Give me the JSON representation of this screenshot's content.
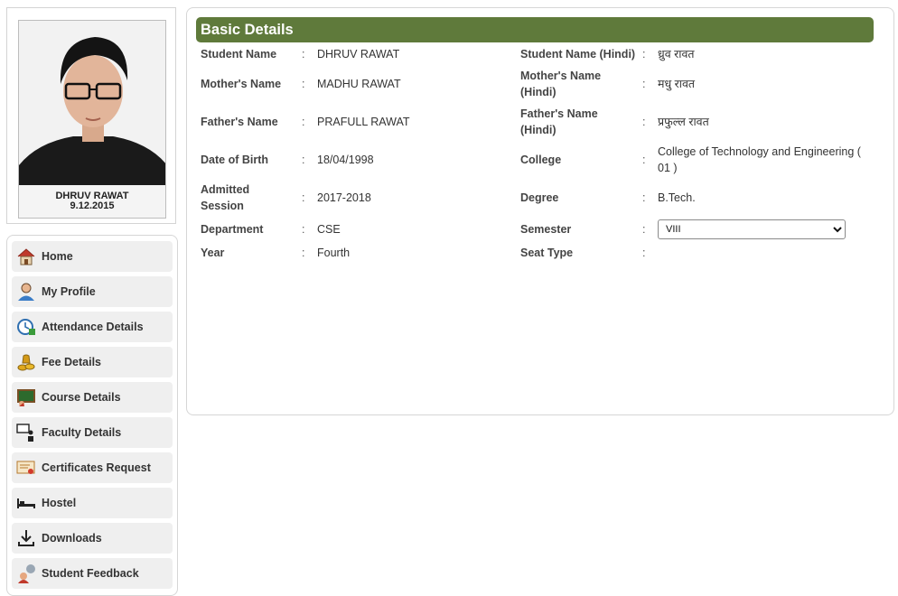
{
  "photo": {
    "caption_name": "DHRUV RAWAT",
    "caption_date": "9.12.2015"
  },
  "nav": [
    {
      "label": "Home",
      "icon": "home-icon"
    },
    {
      "label": "My Profile",
      "icon": "user-profile-icon"
    },
    {
      "label": "Attendance Details",
      "icon": "attendance-clock-icon"
    },
    {
      "label": "Fee Details",
      "icon": "money-coins-icon"
    },
    {
      "label": "Course Details",
      "icon": "chalkboard-icon"
    },
    {
      "label": "Faculty Details",
      "icon": "faculty-presenter-icon"
    },
    {
      "label": "Certificates Request",
      "icon": "certificate-icon"
    },
    {
      "label": "Hostel",
      "icon": "bed-icon"
    },
    {
      "label": "Downloads",
      "icon": "download-icon"
    },
    {
      "label": "Student Feedback",
      "icon": "feedback-speech-icon"
    }
  ],
  "panel": {
    "title": "Basic Details",
    "colon": ":",
    "left": [
      {
        "label": "Student Name",
        "value": "DHRUV RAWAT"
      },
      {
        "label": "Mother's Name",
        "value": "MADHU RAWAT"
      },
      {
        "label": "Father's Name",
        "value": "PRAFULL RAWAT"
      },
      {
        "label": "Date of Birth",
        "value": "18/04/1998"
      },
      {
        "label": "Admitted Session",
        "value": "2017-2018"
      },
      {
        "label": "Department",
        "value": "CSE"
      },
      {
        "label": "Year",
        "value": "Fourth"
      }
    ],
    "right": [
      {
        "label": "Student Name (Hindi)",
        "value": "ध्रुव रावत"
      },
      {
        "label": "Mother's Name (Hindi)",
        "value": "मधु रावत"
      },
      {
        "label": "Father's Name (Hindi)",
        "value": "प्रफुल्ल रावत"
      },
      {
        "label": "College",
        "value": "College of Technology and Engineering ( 01 )"
      },
      {
        "label": "Degree",
        "value": "B.Tech."
      },
      {
        "label": "Semester",
        "value": "VIII"
      },
      {
        "label": "Seat Type",
        "value": ""
      }
    ]
  },
  "colors": {
    "header": "#5f7a3b",
    "nav_bg": "#efefef"
  }
}
